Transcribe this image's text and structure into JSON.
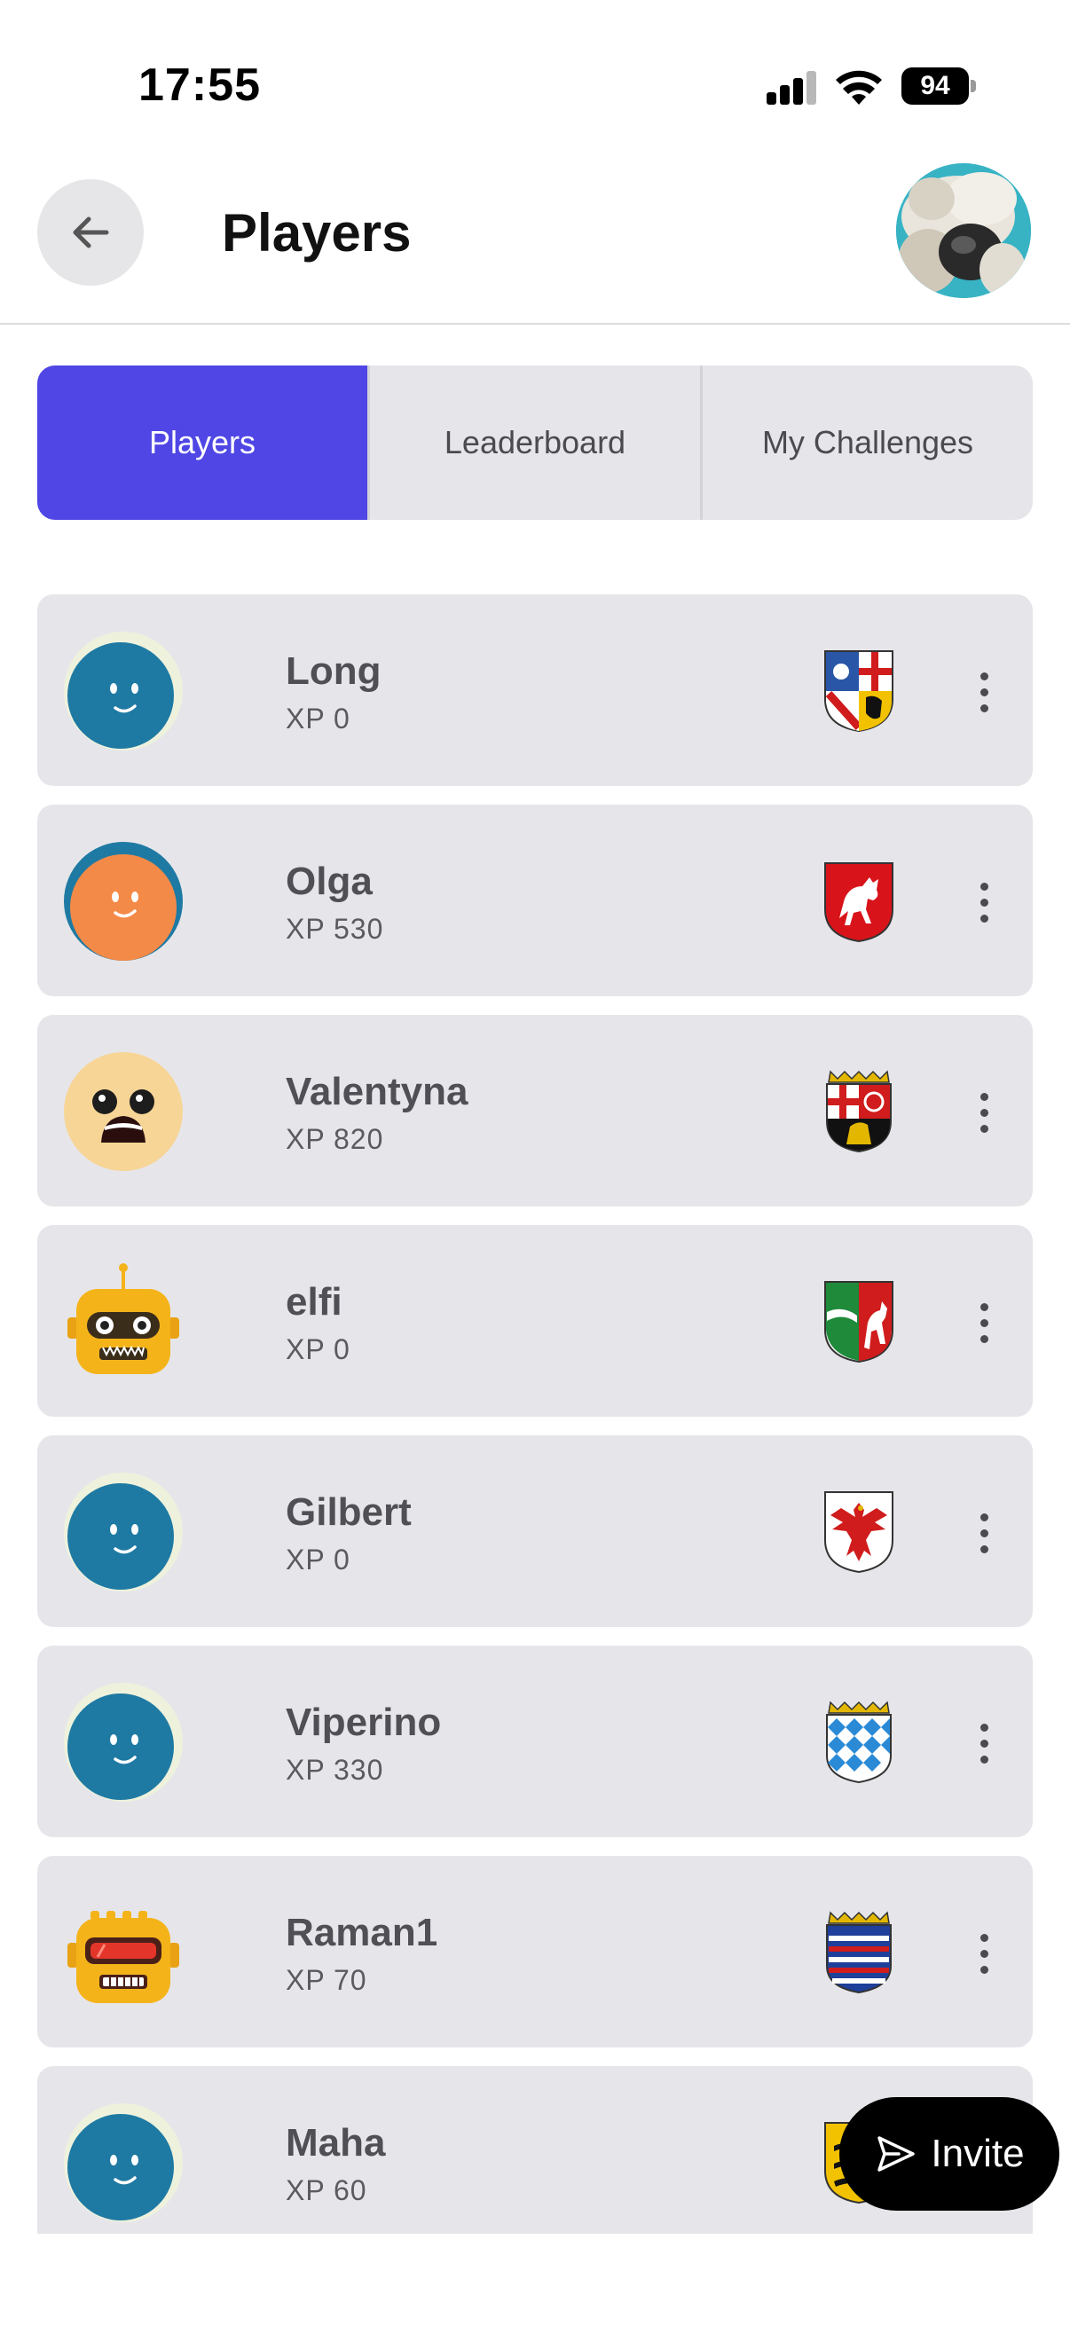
{
  "status_bar": {
    "time": "17:55",
    "battery": "94"
  },
  "header": {
    "title": "Players"
  },
  "tabs": [
    {
      "label": "Players",
      "active": true
    },
    {
      "label": "Leaderboard",
      "active": false
    },
    {
      "label": "My Challenges",
      "active": false
    }
  ],
  "players": [
    {
      "name": "Long",
      "xp": "XP 0",
      "avatar": "blue-smiley-avatar",
      "flag": "saarland-coat-of-arms"
    },
    {
      "name": "Olga",
      "xp": "XP 530",
      "avatar": "orange-smiley-avatar",
      "flag": "lower-saxony-coat-of-arms"
    },
    {
      "name": "Valentyna",
      "xp": "XP 820",
      "avatar": "scared-face-avatar",
      "flag": "rhineland-palatinate-coat-of-arms"
    },
    {
      "name": "elfi",
      "xp": "XP 0",
      "avatar": "robot-avatar",
      "flag": "north-rhine-westphalia-coat-of-arms"
    },
    {
      "name": "Gilbert",
      "xp": "XP 0",
      "avatar": "blue-smiley-avatar",
      "flag": "brandenburg-coat-of-arms"
    },
    {
      "name": "Viperino",
      "xp": "XP 330",
      "avatar": "blue-smiley-avatar",
      "flag": "bavaria-coat-of-arms"
    },
    {
      "name": "Raman1",
      "xp": "XP 70",
      "avatar": "robot-visor-avatar",
      "flag": "hesse-coat-of-arms"
    },
    {
      "name": "Maha",
      "xp": "XP 60",
      "avatar": "blue-smiley-avatar",
      "flag": "baden-wuerttemberg-coat-of-arms"
    }
  ],
  "invite_button": {
    "label": "Invite"
  },
  "colors": {
    "accent": "#4f46e5",
    "card_bg": "#e6e6ea",
    "fab_bg": "#000000"
  }
}
